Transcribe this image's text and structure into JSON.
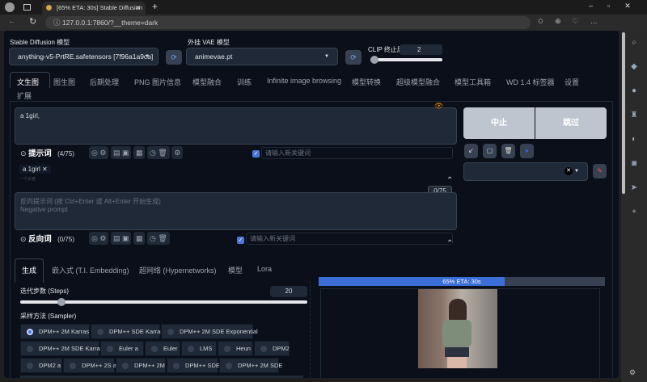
{
  "browser": {
    "tab_title": "[65% ETA: 30s] Stable Diffusion",
    "url": "127.0.0.1:7860/?__theme=dark"
  },
  "top": {
    "sd_model_label": "Stable Diffusion 模型",
    "sd_model_value": "anything-v5-PrtRE.safetensors [7f96a1a9ca]",
    "vae_label": "外挂 VAE 模型",
    "vae_value": "animevae.pt",
    "clip_label": "CLIP 终止层数",
    "clip_value": "2"
  },
  "tabs": [
    "文生图",
    "图生图",
    "后期处理",
    "PNG 图片信息",
    "模型融合",
    "训练",
    "Infinite image browsing",
    "模型转换",
    "超级模型融合",
    "模型工具箱",
    "WD 1.4 标签器",
    "设置",
    "扩展"
  ],
  "prompt": {
    "value": "a 1girl,",
    "label": "提示词",
    "count": "(4/75)",
    "keyword_placeholder": "请输入新关键词",
    "tag": "a 1girl",
    "tag_sub": "一个女孩"
  },
  "negative": {
    "placeholder": "反向提示词 (按 Ctrl+Enter 或 Alt+Enter 开始生成)",
    "placeholder2": "Negative prompt",
    "label": "反向词",
    "count": "(0/75)",
    "token_count": "0/75",
    "keyword_placeholder": "请输入新关键词"
  },
  "actions": {
    "interrupt": "中止",
    "skip": "跳过"
  },
  "subtabs": [
    "生成",
    "嵌入式 (T.I. Embedding)",
    "超网络 (Hypernetworks)",
    "模型",
    "Lora"
  ],
  "steps": {
    "label": "迭代步数 (Steps)",
    "value": "20",
    "fraction": 0.13
  },
  "sampler": {
    "label": "采样方法 (Sampler)",
    "rows": [
      [
        "DPM++ 2M Karras",
        "DPM++ SDE Karras",
        "DPM++ 2M SDE Exponential"
      ],
      [
        "DPM++ 2M SDE Karras",
        "Euler a",
        "Euler",
        "LMS",
        "Heun",
        "DPM2"
      ],
      [
        "DPM2 a",
        "DPM++ 2S a",
        "DPM++ 2M",
        "DPM++ SDE",
        "DPM++ 2M SDE"
      ]
    ],
    "selected": "DPM++ 2M Karras"
  },
  "progress": {
    "text": "65% ETA: 30s",
    "percent": 65
  }
}
